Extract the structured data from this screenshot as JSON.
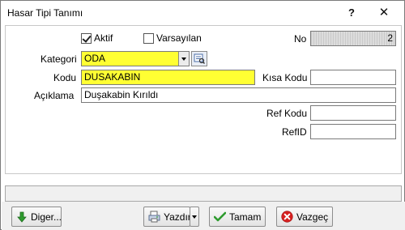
{
  "window": {
    "title": "Hasar Tipi Tanımı",
    "help_glyph": "?",
    "close_glyph": "✕"
  },
  "form": {
    "aktif": {
      "label": "Aktif",
      "checked": true
    },
    "varsayilan": {
      "label": "Varsayılan",
      "checked": false
    },
    "no": {
      "label": "No",
      "value": "2"
    },
    "kategori": {
      "label": "Kategori",
      "value": "ODA"
    },
    "kodu": {
      "label": "Kodu",
      "value": "DUSAKABIN"
    },
    "kisa_kodu": {
      "label": "Kısa Kodu",
      "value": ""
    },
    "aciklama": {
      "label": "Açıklama",
      "value": "Duşakabin Kırıldı"
    },
    "ref_kodu": {
      "label": "Ref Kodu",
      "value": ""
    },
    "ref_id": {
      "label": "RefID",
      "value": ""
    }
  },
  "buttons": {
    "diger": {
      "label": "Diger...",
      "icon": "green-down-arrow-icon"
    },
    "yazdir": {
      "label": "Yazdır",
      "icon": "printer-icon"
    },
    "tamam": {
      "label": "Tamam",
      "icon": "green-check-icon"
    },
    "vazgec": {
      "label": "Vazgeç",
      "icon": "red-cancel-icon"
    }
  },
  "colors": {
    "required_field": "#ffff33",
    "readonly_field": "#d4d4d4",
    "ok_icon": "#2e9b2e",
    "cancel_icon": "#d62020"
  }
}
